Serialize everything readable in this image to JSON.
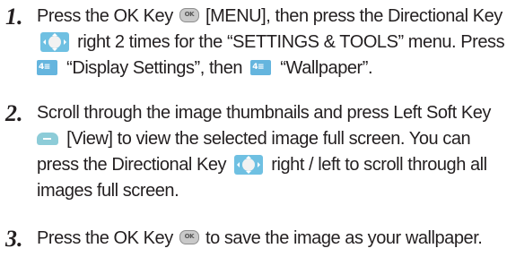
{
  "steps": [
    {
      "number": "1.",
      "lines": [
        [
          "Press the OK Key",
          "[MENU], then press the Directional Key"
        ],
        [
          "right 2 times for the “SETTINGS & TOOLS” menu. Press"
        ],
        [
          "“Display Settings”, then",
          "“Wallpaper”."
        ]
      ]
    },
    {
      "number": "2.",
      "lines": [
        [
          "Scroll through the image thumbnails and press Left Soft Key"
        ],
        [
          "[View] to view the selected image full screen. You can"
        ],
        [
          "press the Directional Key",
          "right / left to scroll through all"
        ],
        [
          "images full screen."
        ]
      ]
    },
    {
      "number": "3.",
      "lines": [
        [
          "Press the OK Key",
          "to save the image as your wallpaper."
        ]
      ]
    }
  ],
  "icons": {
    "ok": "ok-key-icon",
    "directional": "directional-key-icon",
    "tab": "tab-key-icon",
    "soft": "left-soft-key-icon"
  },
  "colors": {
    "text": "#231f20",
    "key_blue": "#65b5de",
    "soft_key": "#8dccd8"
  }
}
